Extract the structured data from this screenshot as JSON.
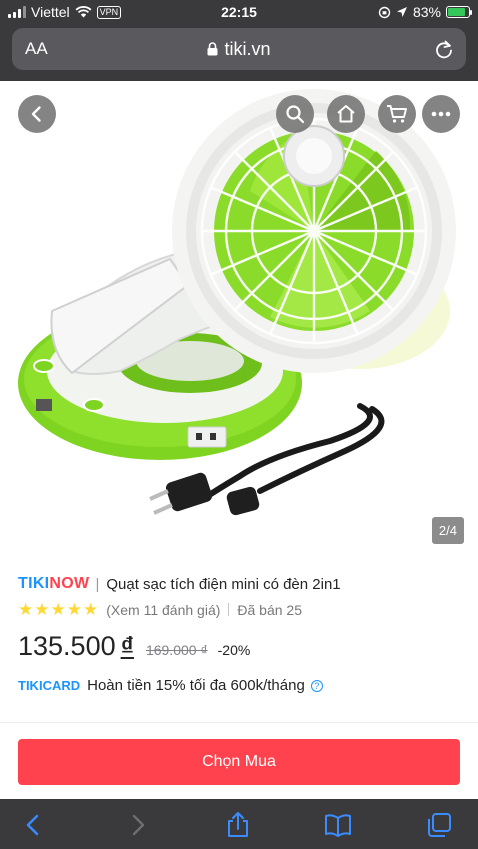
{
  "status_bar": {
    "carrier": "Viettel",
    "vpn": "VPN",
    "time": "22:15",
    "battery_percent": "83%",
    "battery_level": 0.83
  },
  "browser": {
    "text_size_label": "AA",
    "domain": "tiki.vn"
  },
  "gallery": {
    "counter": "2/4",
    "buttons": [
      "back-icon",
      "search-icon",
      "home-icon",
      "cart-icon",
      "more-icon"
    ]
  },
  "product": {
    "brand_logo_tiki": "TIKI",
    "brand_logo_now": "NOW",
    "title": "Quạt sạc tích điện mini có đèn 2in1",
    "rating": 5,
    "review_link": "(Xem 11 đánh giá)",
    "sold": "Đã bán 25",
    "price": "135.500",
    "currency": "₫",
    "old_price": "169.000 ₫",
    "discount": "-20%"
  },
  "tikicard": {
    "logo_tiki": "TIKI",
    "logo_card": "CARD",
    "cashback_text": "Hoàn tiền 15% tối đa 600k/tháng",
    "help": "?"
  },
  "actions": {
    "buy_label": "Chọn Mua"
  },
  "colors": {
    "brand_blue": "#1a94ff",
    "brand_red": "#ff424e",
    "star": "#fdd836",
    "chrome": "#3a3a3c"
  }
}
